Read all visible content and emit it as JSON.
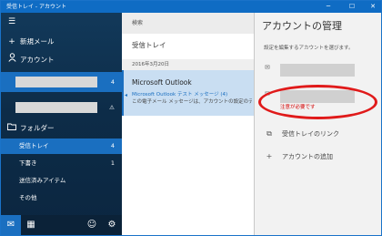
{
  "window": {
    "title": "受信トレイ - アカウント"
  },
  "sidebar": {
    "new_mail": "新規メール",
    "accounts_label": "アカウント",
    "accounts": [
      {
        "count": "4"
      },
      {
        "count": "⚠"
      }
    ],
    "folders_label": "フォルダー",
    "folders": [
      {
        "label": "受信トレイ",
        "count": "4"
      },
      {
        "label": "下書き",
        "count": "1"
      },
      {
        "label": "送信済みアイテム",
        "count": ""
      },
      {
        "label": "その他",
        "count": ""
      }
    ]
  },
  "middle": {
    "search_placeholder": "検索",
    "inbox_title": "受信トレイ",
    "date_header": "2016年3月20日",
    "message": {
      "from": "Microsoft Outlook",
      "subject": "Microsoft Outlook テスト メッセージ (4)",
      "preview": "この電子メール メッセージは、アカウントの設定のテスト中に"
    }
  },
  "right": {
    "title": "アカウントの管理",
    "description": "設定を編集するアカウントを選びます。",
    "error_text": "注意が必要です",
    "link_inboxes": "受信トレイのリンク",
    "add_account": "アカウントの追加"
  },
  "colors": {
    "accent": "#1a6fc0",
    "error": "#d40000",
    "highlight_ellipse": "#e01a1a"
  }
}
